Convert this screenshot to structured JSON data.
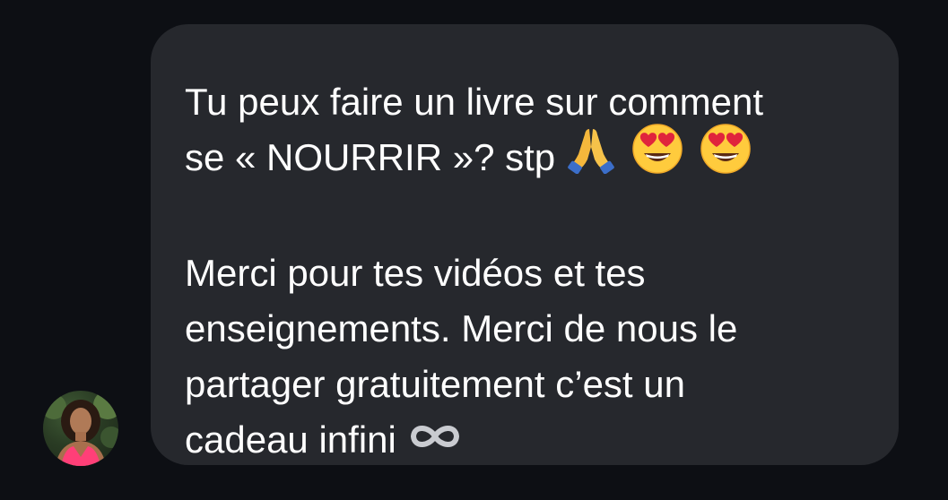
{
  "message": {
    "line1": "Tu peux faire un livre sur comment",
    "line2": "se « NOURRIR »? stp",
    "paragraph2": "Merci pour tes vidéos et tes\nenseignements. Merci de nous le\npartager gratuitement c’est un\ncadeau infini",
    "emojis": [
      "folded-hands-emoji",
      "heart-eyes-emoji",
      "heart-eyes-emoji"
    ],
    "trailing_icon": "infinity-icon"
  },
  "sender": {
    "avatar_icon": "profile-photo"
  },
  "colors": {
    "background": "#0d0f14",
    "bubble": "#26282d",
    "text": "#ffffff"
  }
}
